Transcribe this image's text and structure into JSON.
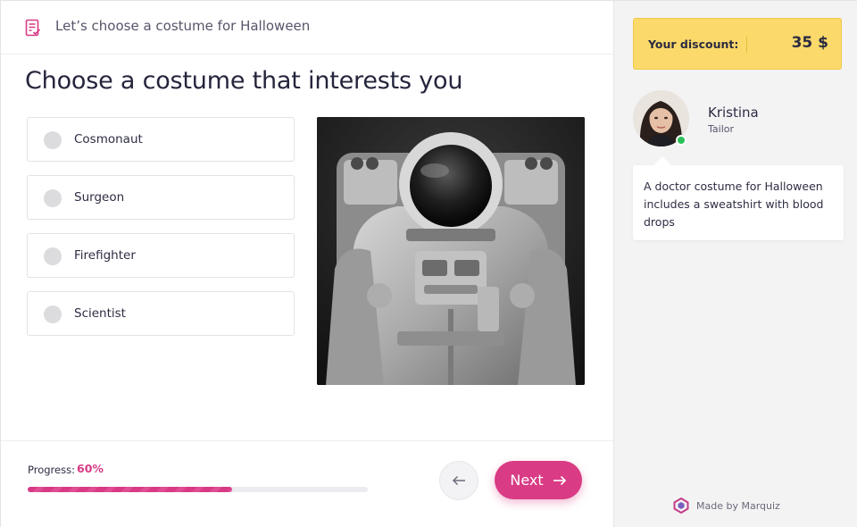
{
  "header": {
    "title": "Let’s choose a costume for Halloween",
    "icon": "checklist-icon"
  },
  "question": {
    "title": "Choose a costume that interests you",
    "options": [
      {
        "label": "Cosmonaut",
        "selected": false
      },
      {
        "label": "Surgeon",
        "selected": false
      },
      {
        "label": "Firefighter",
        "selected": false
      },
      {
        "label": "Scientist",
        "selected": false
      }
    ],
    "image": "astronaut-photo"
  },
  "footer": {
    "progress_label": "Progress:",
    "progress_value": "60%",
    "progress_fraction": 0.6,
    "prev_icon": "arrow-left-icon",
    "next_label": "Next",
    "next_icon": "arrow-right-icon"
  },
  "sidebar": {
    "discount_label": "Your discount:",
    "discount_value": "35 $",
    "consultant": {
      "name": "Kristina",
      "role": "Tailor",
      "status": "online"
    },
    "message": "A doctor costume for Halloween includes a sweatshirt with blood drops",
    "branding": "Made by Marquiz"
  },
  "colors": {
    "accent": "#d93b84",
    "discount_bg": "#fbda6b",
    "online": "#2bbf5a",
    "sidebar_bg": "#f3f3f4"
  }
}
